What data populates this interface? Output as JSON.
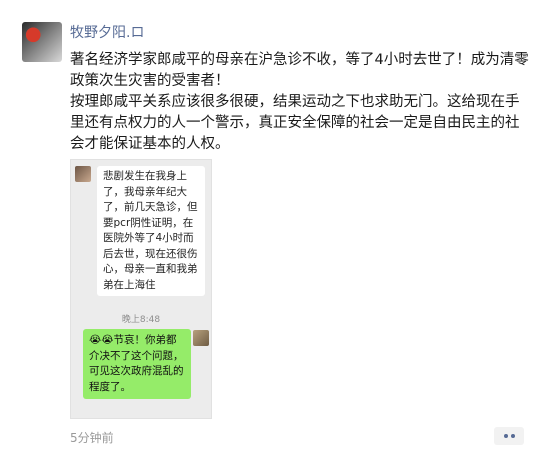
{
  "post": {
    "author": "牧野夕阳.ロ",
    "text": "著名经济学家郎咸平的母亲在沪急诊不收，等了4小时去世了！成为清零政策次生灾害的受害者！",
    "text2": "按理郎咸平关系应该很多很硬，结果运动之下也求助无门。这给现在手里还有点权力的人一个警示，真正安全保障的社会一定是自由民主的社会才能保证基本的人权。",
    "time": "5分钟前"
  },
  "chat": {
    "message1": "悲剧发生在我身上了，我母亲年纪大了，前几天急诊，但要pcr阴性证明，在医院外等了4小时而后去世，现在还很伤心，母亲一直和我弟弟在上海住",
    "timestamp": "晚上8:48",
    "message2": "😭😭节哀！你弟都介决不了这个问题，可见这次政府混乱的程度了。"
  },
  "icons": {
    "more": "more-dots-icon"
  }
}
